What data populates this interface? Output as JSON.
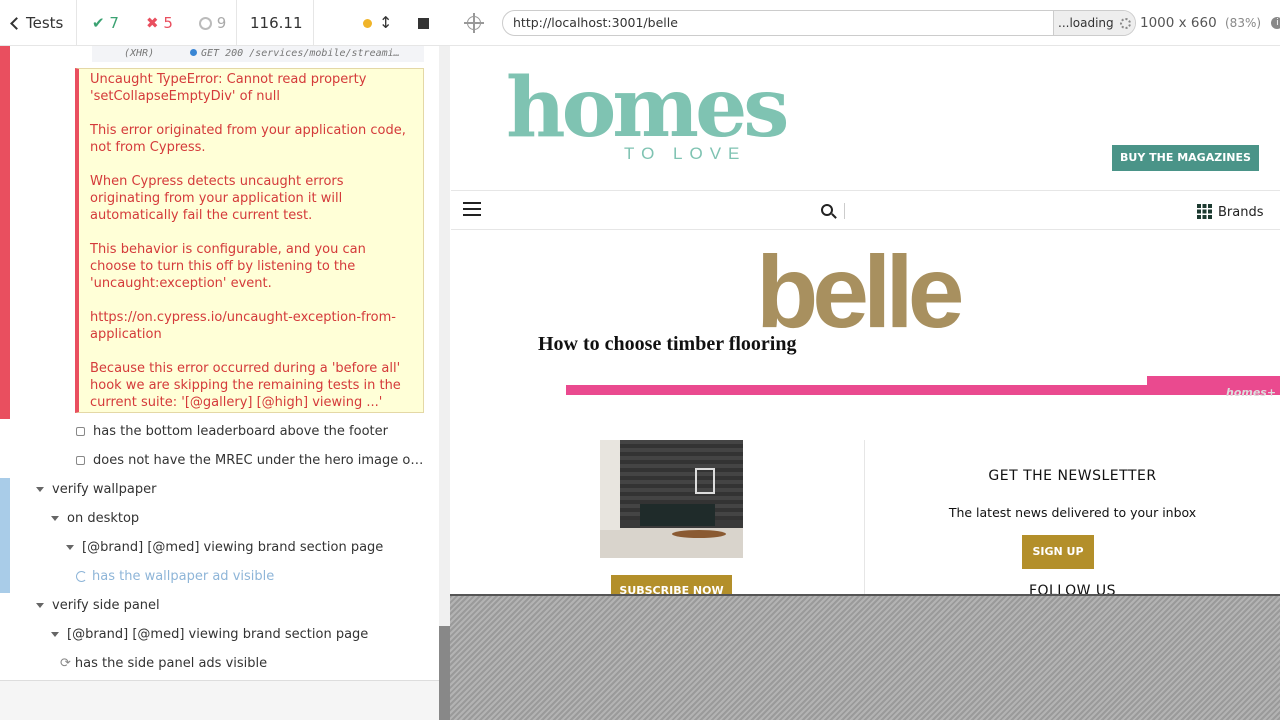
{
  "reporter": {
    "tests_label": "Tests",
    "passed": "7",
    "failed": "5",
    "pending": "9",
    "duration": "116.11",
    "xhr_method": "(XHR)",
    "xhr_text": "GET 200 /services/mobile/streami…",
    "error_paragraphs": [
      "Uncaught TypeError: Cannot read property 'setCollapseEmptyDiv' of null",
      "This error originated from your application code, not from Cypress.",
      "When Cypress detects uncaught errors originating from your application it will automatically fail the current test.",
      "This behavior is configurable, and you can choose to turn this off by listening to the 'uncaught:exception' event.",
      "https://on.cypress.io/uncaught-exception-from-application",
      "Because this error occurred during a 'before all' hook we are skipping the remaining tests in the current suite: '[@gallery] [@high] viewing ...'"
    ],
    "tests": {
      "leaderboard": "has the bottom leaderboard above the footer",
      "mrec": "does not have the MREC under the hero image o…",
      "verify_wallpaper": "verify wallpaper",
      "on_desktop": "on desktop",
      "brand_section_1": "[@brand] [@med] viewing brand section page",
      "wallpaper_ad": "has the wallpaper ad visible",
      "verify_side_panel": "verify side panel",
      "brand_section_2": "[@brand] [@med] viewing brand section page",
      "side_panel_ads": "has the side panel ads visible"
    },
    "colors": {
      "failed": "#e94f5f",
      "passed": "#3ba272",
      "running": "#a9cce8"
    }
  },
  "aut": {
    "url": "http://localhost:3001/belle",
    "loading": "...loading",
    "viewport": "1000 x 660",
    "scale": "(83%)"
  },
  "site": {
    "logo_main": "homes",
    "logo_sub": "TO LOVE",
    "buy_button": "BUY THE MAGAZINES",
    "brands": "Brands",
    "brand_logo": "belle",
    "article_title": "How to choose timber flooring",
    "homes_watermark": "homes+",
    "newsletter_title": "GET THE NEWSLETTER",
    "newsletter_text": "The latest news delivered to your inbox",
    "signup": "SIGN UP",
    "follow": "FOLLOW US",
    "subscribe": "SUBSCRIBE NOW",
    "colors": {
      "teal": "#7fc3b2",
      "gold": "#a8905f",
      "pink": "#ea4a8f"
    }
  }
}
